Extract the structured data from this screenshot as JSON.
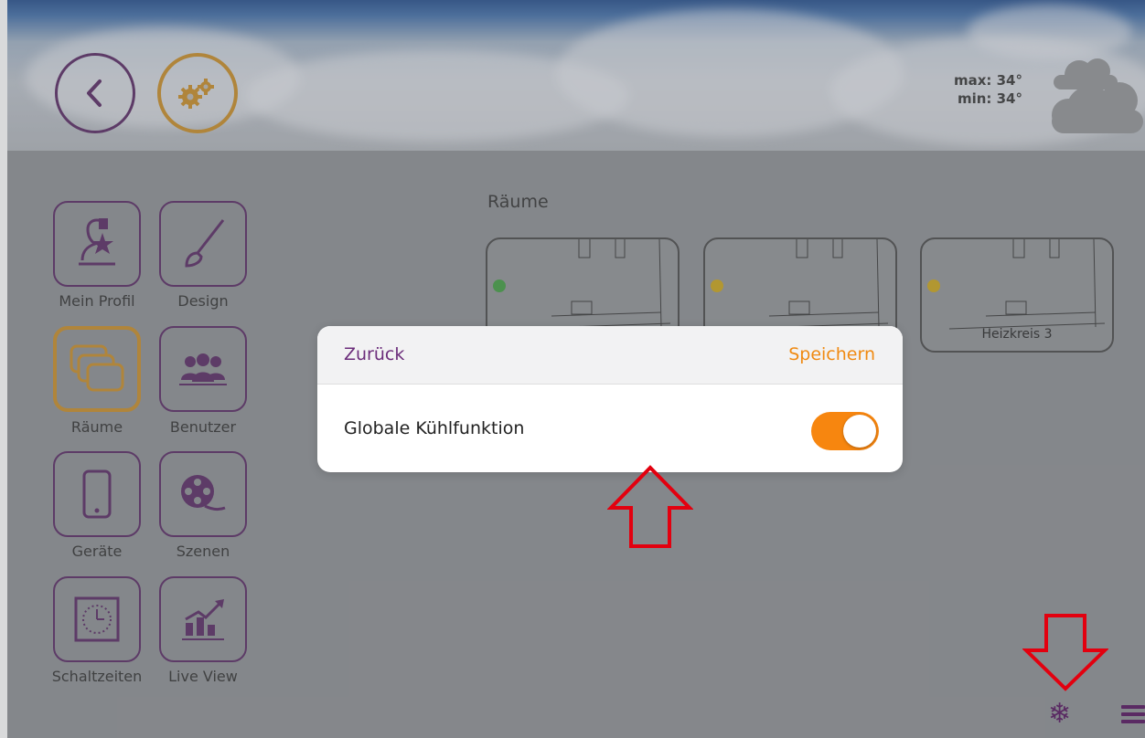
{
  "header": {
    "weather": {
      "max": "max: 34°",
      "min": "min: 34°",
      "icon": "cloud-icon"
    },
    "back_icon": "chevron-left-icon",
    "settings_icon": "gears-icon"
  },
  "sidebar": {
    "items": [
      {
        "label": "Mein Profil",
        "icon": "profile-icon"
      },
      {
        "label": "Design",
        "icon": "brush-icon"
      },
      {
        "label": "Räume",
        "icon": "rooms-icon",
        "active": true
      },
      {
        "label": "Benutzer",
        "icon": "users-icon"
      },
      {
        "label": "Geräte",
        "icon": "device-icon"
      },
      {
        "label": "Szenen",
        "icon": "film-reel-icon"
      },
      {
        "label": "Schaltzeiten",
        "icon": "clock-icon"
      },
      {
        "label": "Live View",
        "icon": "chart-icon"
      }
    ]
  },
  "rooms": {
    "title": "Räume",
    "cards": [
      {
        "name": "",
        "status": "ok",
        "status_color": "#3c9a3c"
      },
      {
        "name": "",
        "status": "warning",
        "status_color": "#c9a214"
      },
      {
        "name": "Heizkreis 3",
        "status": "warning",
        "status_color": "#c9a214"
      }
    ]
  },
  "modal": {
    "back_label": "Zurück",
    "save_label": "Speichern",
    "setting_label": "Globale Kühlfunktion",
    "toggle_on": true
  },
  "bottom_bar": {
    "snowflake_icon": "snowflake-icon",
    "menu_icon": "menu-icon"
  },
  "colors": {
    "purple": "#54235f",
    "orange": "#f7860f",
    "gold": "#c68a22",
    "arrow_red": "#e3000f"
  }
}
